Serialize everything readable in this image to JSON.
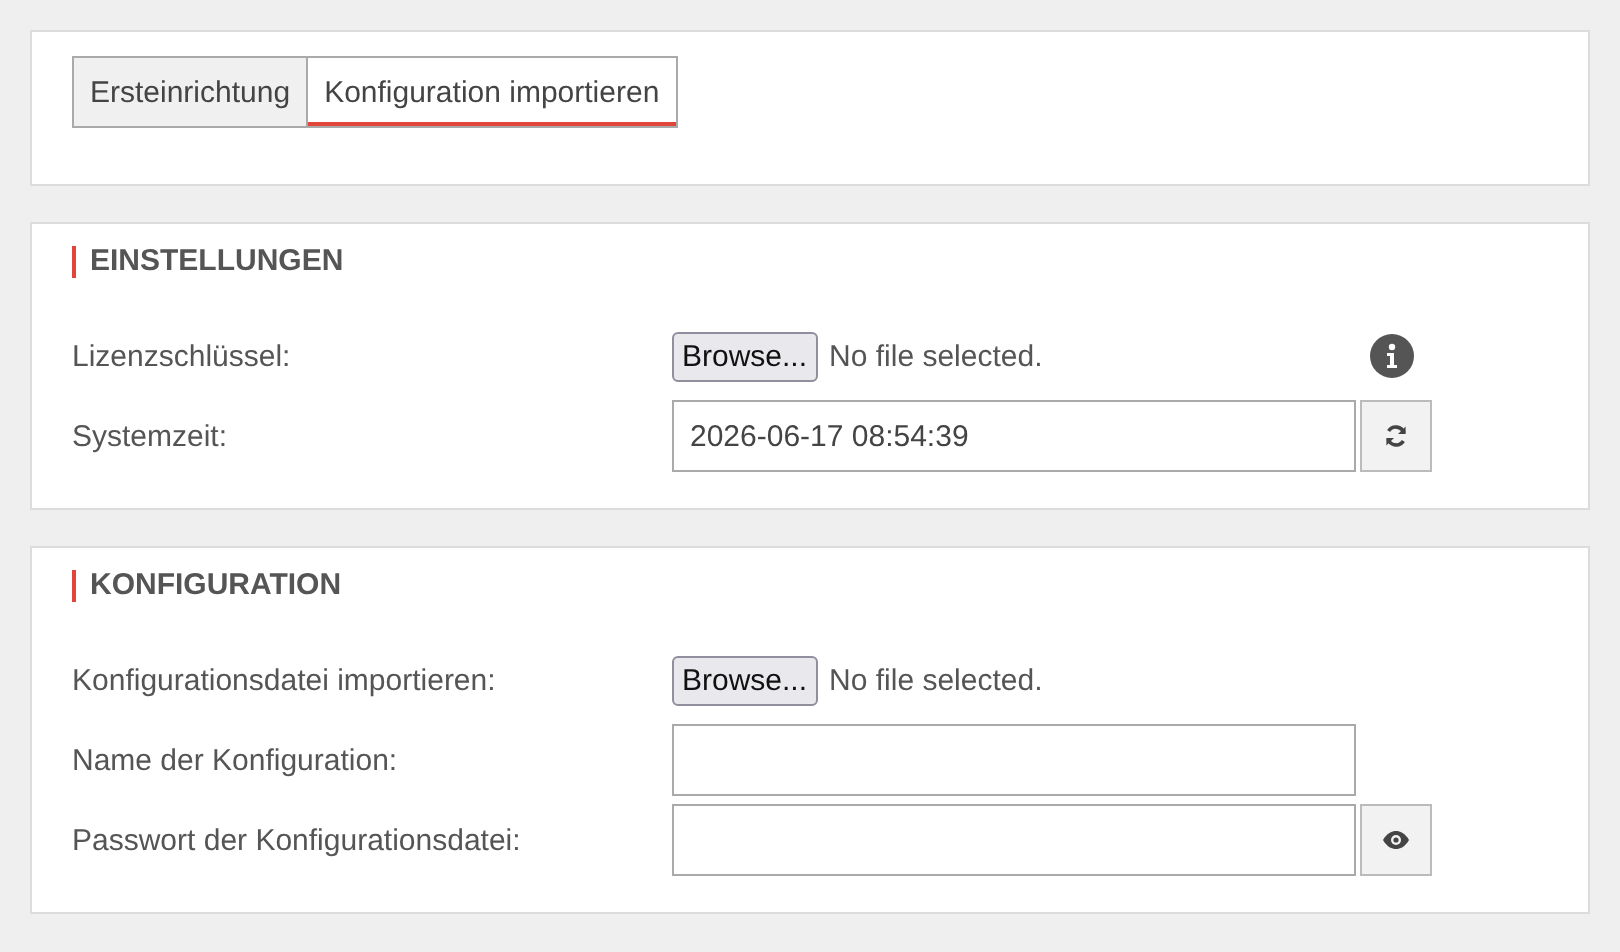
{
  "tabs": [
    {
      "label": "Ersteinrichtung",
      "selected": false
    },
    {
      "label": "Konfiguration importieren",
      "selected": true
    }
  ],
  "sections": [
    {
      "title": "EINSTELLUNGEN",
      "fields": [
        {
          "kind": "file",
          "label": "Lizenzschlüssel:",
          "button": "Browse...",
          "status": "No file selected.",
          "info": true
        },
        {
          "kind": "text",
          "label": "Systemzeit:",
          "value": "2026-06-17 08:54:39",
          "addon": {
            "kind": "refresh"
          }
        }
      ]
    },
    {
      "title": "KONFIGURATION",
      "fields": [
        {
          "kind": "file",
          "label": "Konfigurationsdatei importieren:",
          "button": "Browse...",
          "status": "No file selected."
        },
        {
          "kind": "text",
          "label": "Name der Konfiguration:"
        },
        {
          "kind": "password",
          "label": "Passwort der Konfigurationsdatei:",
          "addon": {
            "kind": "reveal"
          }
        }
      ]
    }
  ]
}
